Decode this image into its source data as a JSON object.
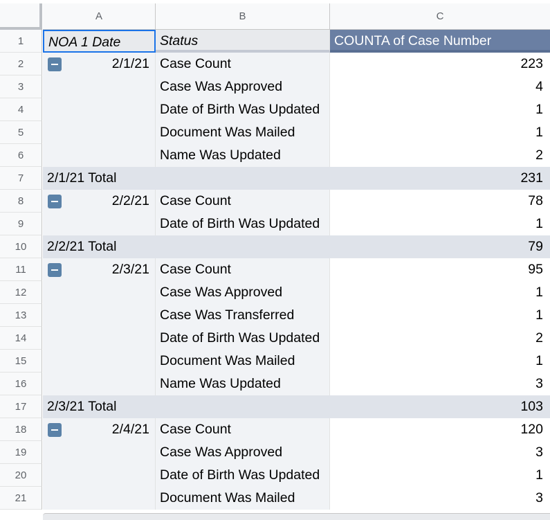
{
  "columns": [
    "A",
    "B",
    "C"
  ],
  "header": {
    "row": "1",
    "a": "NOA 1 Date",
    "b": "Status",
    "c": "COUNTA of Case Number"
  },
  "rows": [
    {
      "row": "2",
      "a": "2/1/21",
      "b": "Case Count",
      "c": "223",
      "kind": "group"
    },
    {
      "row": "3",
      "a": "",
      "b": "Case Was Approved",
      "c": "4",
      "kind": "detail"
    },
    {
      "row": "4",
      "a": "",
      "b": "Date of Birth Was Updated",
      "c": "1",
      "kind": "detail"
    },
    {
      "row": "5",
      "a": "",
      "b": "Document Was Mailed",
      "c": "1",
      "kind": "detail"
    },
    {
      "row": "6",
      "a": "",
      "b": "Name Was Updated",
      "c": "2",
      "kind": "detail"
    },
    {
      "row": "7",
      "a": "2/1/21 Total",
      "b": "",
      "c": "231",
      "kind": "total"
    },
    {
      "row": "8",
      "a": "2/2/21",
      "b": "Case Count",
      "c": "78",
      "kind": "group"
    },
    {
      "row": "9",
      "a": "",
      "b": "Date of Birth Was Updated",
      "c": "1",
      "kind": "detail"
    },
    {
      "row": "10",
      "a": "2/2/21 Total",
      "b": "",
      "c": "79",
      "kind": "total"
    },
    {
      "row": "11",
      "a": "2/3/21",
      "b": "Case Count",
      "c": "95",
      "kind": "group"
    },
    {
      "row": "12",
      "a": "",
      "b": "Case Was Approved",
      "c": "1",
      "kind": "detail"
    },
    {
      "row": "13",
      "a": "",
      "b": "Case Was Transferred",
      "c": "1",
      "kind": "detail"
    },
    {
      "row": "14",
      "a": "",
      "b": "Date of Birth Was Updated",
      "c": "2",
      "kind": "detail"
    },
    {
      "row": "15",
      "a": "",
      "b": "Document Was Mailed",
      "c": "1",
      "kind": "detail"
    },
    {
      "row": "16",
      "a": "",
      "b": "Name Was Updated",
      "c": "3",
      "kind": "detail"
    },
    {
      "row": "17",
      "a": "2/3/21 Total",
      "b": "",
      "c": "103",
      "kind": "total"
    },
    {
      "row": "18",
      "a": "2/4/21",
      "b": "Case Count",
      "c": "120",
      "kind": "group"
    },
    {
      "row": "19",
      "a": "",
      "b": "Case Was Approved",
      "c": "3",
      "kind": "detail"
    },
    {
      "row": "20",
      "a": "",
      "b": "Date of Birth Was Updated",
      "c": "1",
      "kind": "detail"
    },
    {
      "row": "21",
      "a": "",
      "b": "Document Was Mailed",
      "c": "3",
      "kind": "detail"
    }
  ],
  "icons": {
    "collapse": "minus-square-icon"
  },
  "colors": {
    "header_c_bg": "#6a7fa3",
    "total_bg": "#dfe3ea",
    "label_bg": "#f1f3f6",
    "selection": "#1a73e8",
    "collapse_icon": "#5b82a8"
  }
}
